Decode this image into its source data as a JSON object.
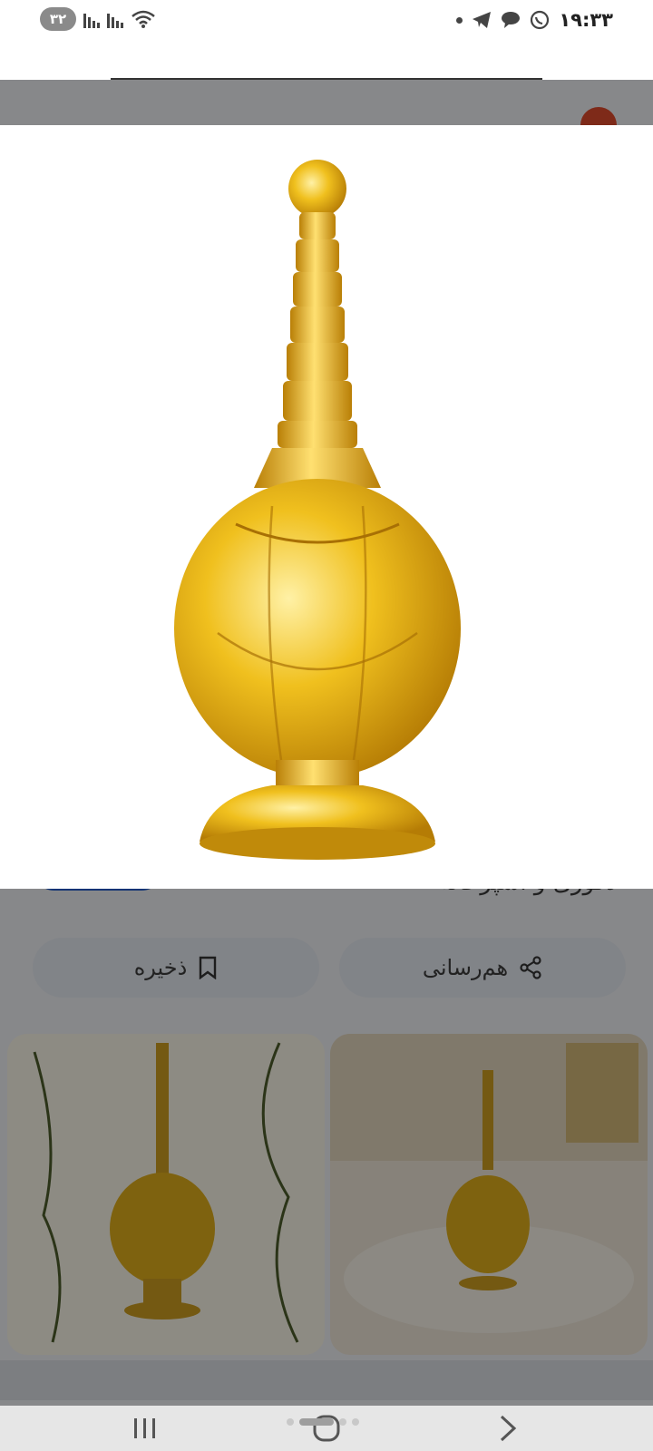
{
  "status_bar": {
    "battery": "۳۲",
    "time": "۱۹:۳۳"
  },
  "background_page": {
    "title_partial": "دکوری و آشپزخانه",
    "share_label": "هم‌رسانی",
    "save_label": "ذخیره"
  },
  "icons": {
    "share": "share-icon",
    "save": "bookmark-icon",
    "wifi": "wifi-icon",
    "telegram": "telegram-icon",
    "chat": "chat-icon",
    "whatsapp": "whatsapp-icon"
  },
  "colors": {
    "gold": "#e0a80f",
    "accent_blue": "#1a56c8"
  }
}
